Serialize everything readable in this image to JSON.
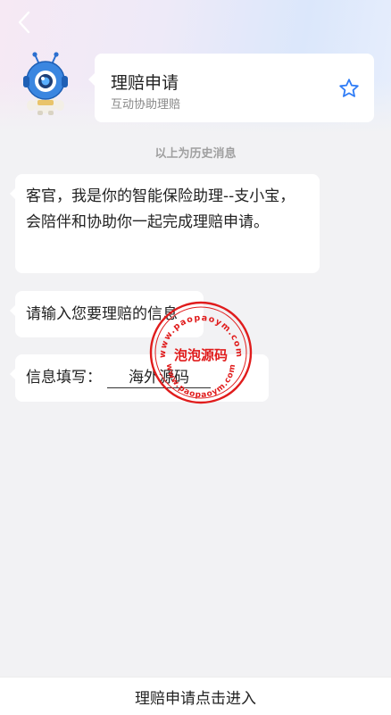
{
  "header": {
    "back_icon": "chevron-left-icon",
    "card": {
      "title": "理赔申请",
      "subtitle": "互动协助理赔",
      "star_icon": "star-outline-icon",
      "accent_color": "#2f7cf6"
    }
  },
  "chat": {
    "history_label": "以上为历史消息",
    "messages": [
      {
        "text": "客官，我是你的智能保险助理--支小宝，会陪伴和协助你一起完成理赔申请。"
      },
      {
        "text": "请输入您要理赔的信息"
      },
      {
        "label": "信息填写：",
        "value": "海外源码"
      }
    ]
  },
  "watermark": {
    "top_text": "www.paopaoym.com",
    "center_text": "泡泡源码",
    "bottom_text": "www.paopaoym.com",
    "color": "#e01c1c"
  },
  "footer": {
    "action_label": "理赔申请点击进入"
  }
}
